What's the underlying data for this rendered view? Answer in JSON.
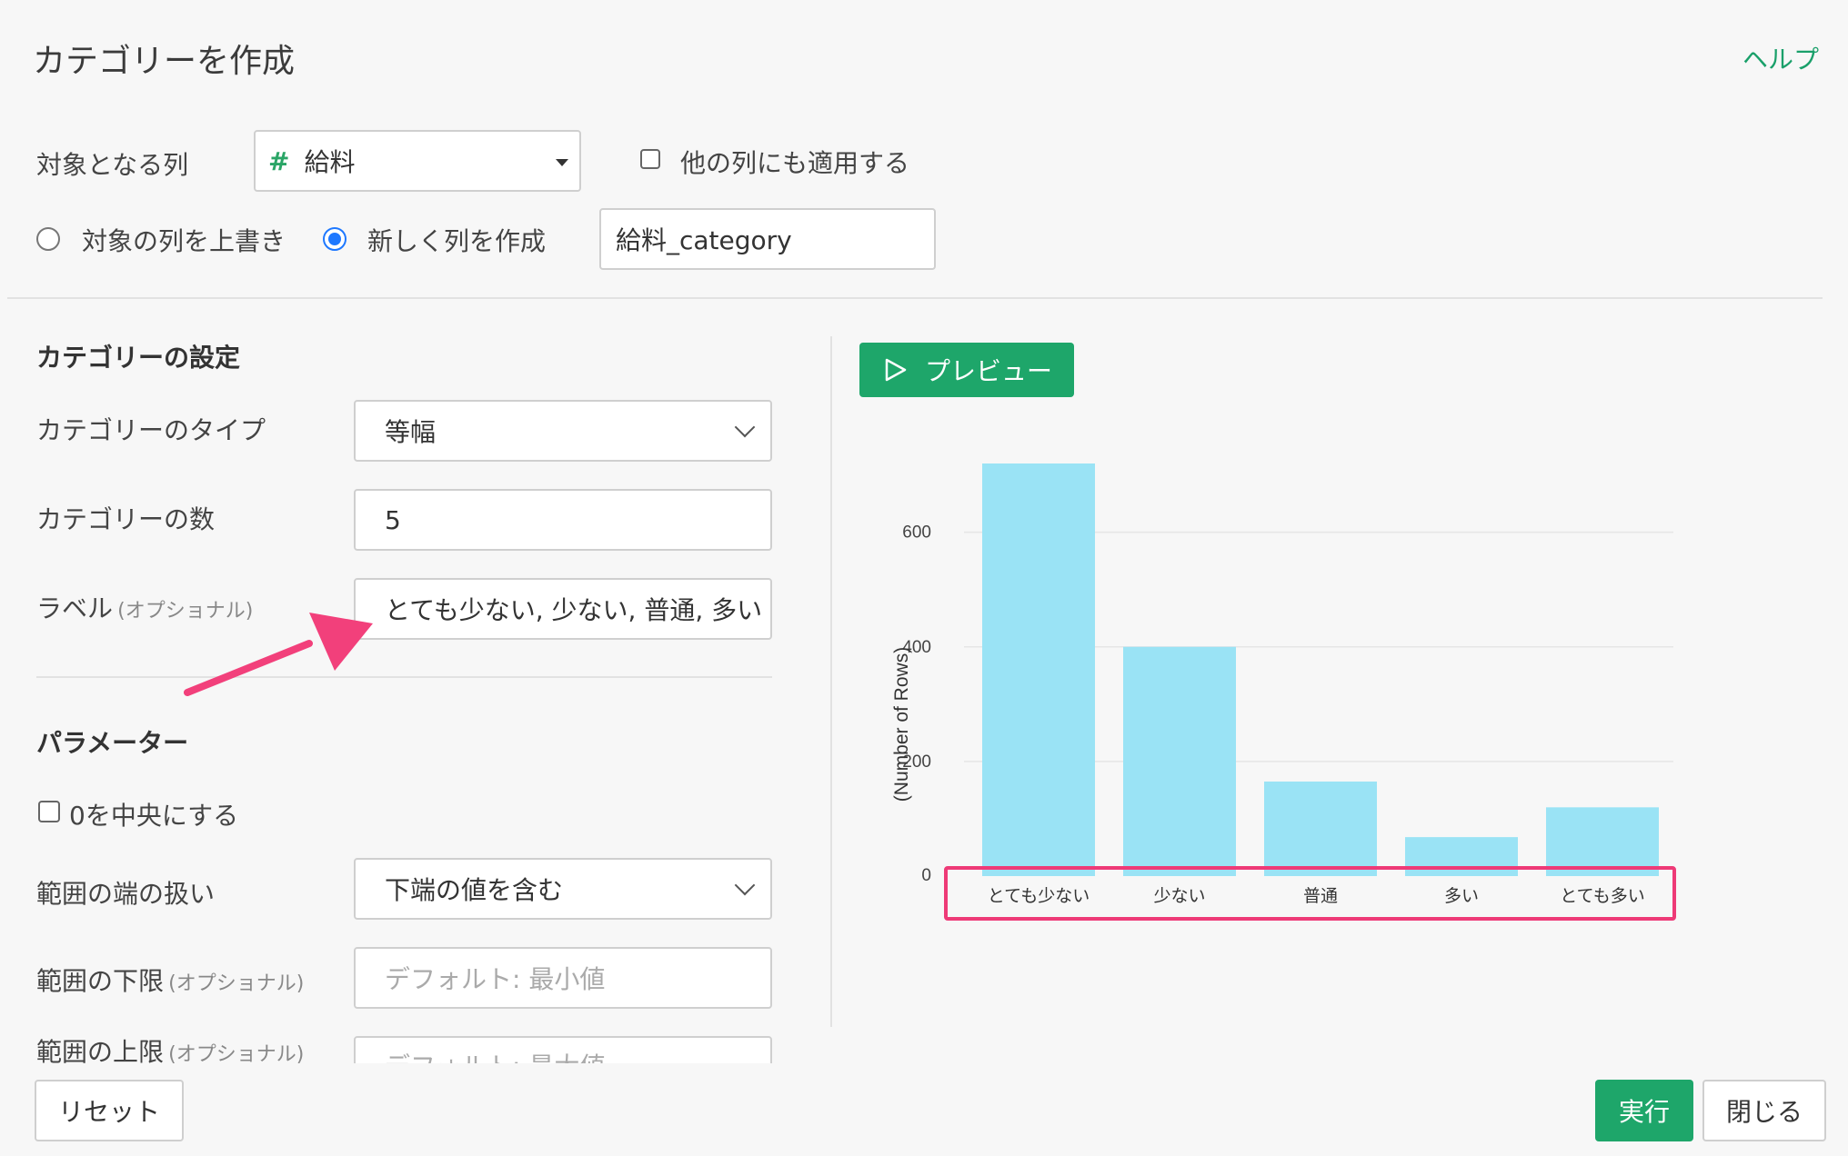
{
  "header": {
    "title": "カテゴリーを作成",
    "help": "ヘルプ"
  },
  "target": {
    "label": "対象となる列",
    "column_icon": "#",
    "column": "給料",
    "apply_other": "他の列にも適用する",
    "overwrite": "対象の列を上書き",
    "create_new": "新しく列を作成",
    "new_column_name": "給料_category"
  },
  "settings": {
    "heading": "カテゴリーの設定",
    "type_label": "カテゴリーのタイプ",
    "type_value": "等幅",
    "count_label": "カテゴリーの数",
    "count_value": "5",
    "label_label": "ラベル",
    "label_optional": "(オプショナル)",
    "label_value": "とても少ない, 少ない, 普通, 多い"
  },
  "params": {
    "heading": "パラメーター",
    "center_zero": "0を中央にする",
    "edge_label": "範囲の端の扱い",
    "edge_value": "下端の値を含む",
    "lower_label": "範囲の下限",
    "lower_optional": "(オプショナル)",
    "lower_placeholder": "デフォルト: 最小値",
    "upper_label": "範囲の上限",
    "upper_optional": "(オプショナル)",
    "upper_placeholder": "デフォルト: 最大値"
  },
  "preview": {
    "button": "プレビュー"
  },
  "footer": {
    "reset": "リセット",
    "run": "実行",
    "close": "閉じる"
  },
  "colors": {
    "accent": "#1ea66a",
    "bar": "#9ae3f5",
    "highlight": "#ee3a77",
    "arrow": "#f2407b"
  },
  "chart_data": {
    "type": "bar",
    "categories": [
      "とても少ない",
      "少ない",
      "普通",
      "多い",
      "とても多い"
    ],
    "values": [
      720,
      400,
      165,
      68,
      120
    ],
    "ylabel": "(Number of Rows)",
    "yticks": [
      0,
      200,
      400,
      600
    ],
    "ylim": [
      0,
      720
    ],
    "grid": true
  }
}
